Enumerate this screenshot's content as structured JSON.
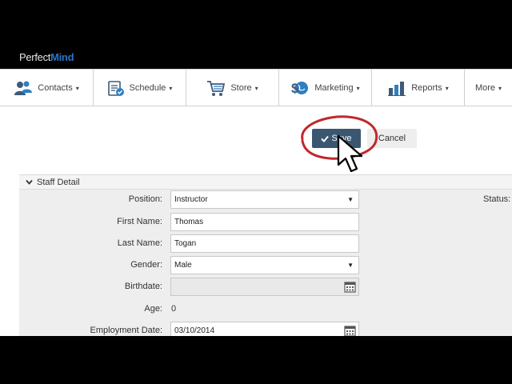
{
  "brand": {
    "part1": "Perfect",
    "part2": "Mind"
  },
  "nav": {
    "items": [
      {
        "label": "Contacts",
        "icon": "contacts-icon"
      },
      {
        "label": "Schedule",
        "icon": "schedule-icon"
      },
      {
        "label": "Store",
        "icon": "cart-icon"
      },
      {
        "label": "Marketing",
        "icon": "marketing-icon"
      },
      {
        "label": "Reports",
        "icon": "reports-icon"
      },
      {
        "label": "More",
        "icon": ""
      }
    ],
    "caret": "▾"
  },
  "actions": {
    "save_label": "Save",
    "cancel_label": "Cancel"
  },
  "panel": {
    "title": "Staff Detail"
  },
  "form": {
    "position": {
      "label": "Position:",
      "value": "Instructor"
    },
    "first_name": {
      "label": "First Name:",
      "value": "Thomas"
    },
    "last_name": {
      "label": "Last Name:",
      "value": "Togan"
    },
    "gender": {
      "label": "Gender:",
      "value": "Male"
    },
    "birthdate": {
      "label": "Birthdate:",
      "value": ""
    },
    "age": {
      "label": "Age:",
      "value": "0"
    },
    "employment_date": {
      "label": "Employment Date:",
      "value": "03/10/2014"
    },
    "status": {
      "label": "Status:"
    }
  },
  "colors": {
    "save_bg": "#3b5670",
    "annotation": "#c0282e",
    "brand_blue": "#2d73c4"
  }
}
